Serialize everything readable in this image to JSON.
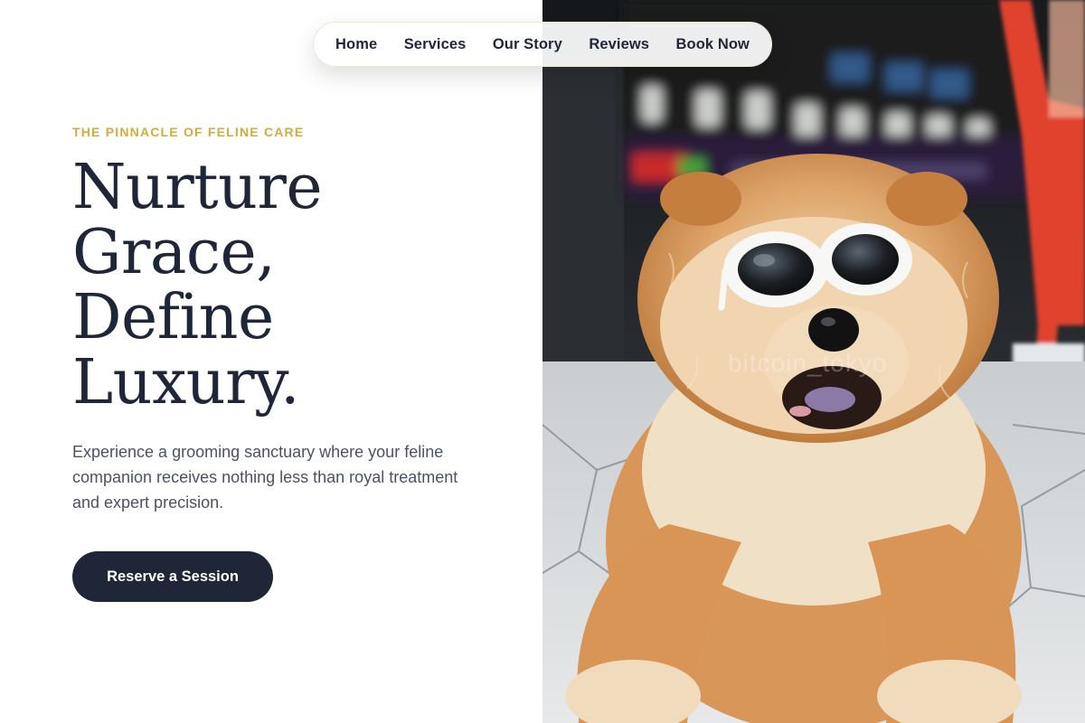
{
  "nav": {
    "items": [
      {
        "label": "Home"
      },
      {
        "label": "Services"
      },
      {
        "label": "Our Story"
      },
      {
        "label": "Reviews"
      },
      {
        "label": "Book Now"
      }
    ]
  },
  "hero": {
    "eyebrow": "THE PINNACLE OF FELINE CARE",
    "headline_lines": [
      "Nurture",
      "Grace,",
      "Define",
      "Luxury."
    ],
    "description": "Experience a grooming sanctuary where your feline companion receives nothing less than royal treatment and expert precision.",
    "cta_label": "Reserve a Session"
  },
  "image": {
    "subject": "fluffy-dog-wearing-white-sunglasses",
    "watermark": "bitcoin_tokyo"
  },
  "colors": {
    "accent_gold": "#d3ac3c",
    "navy": "#1e2638",
    "body_text": "#4a5263"
  }
}
